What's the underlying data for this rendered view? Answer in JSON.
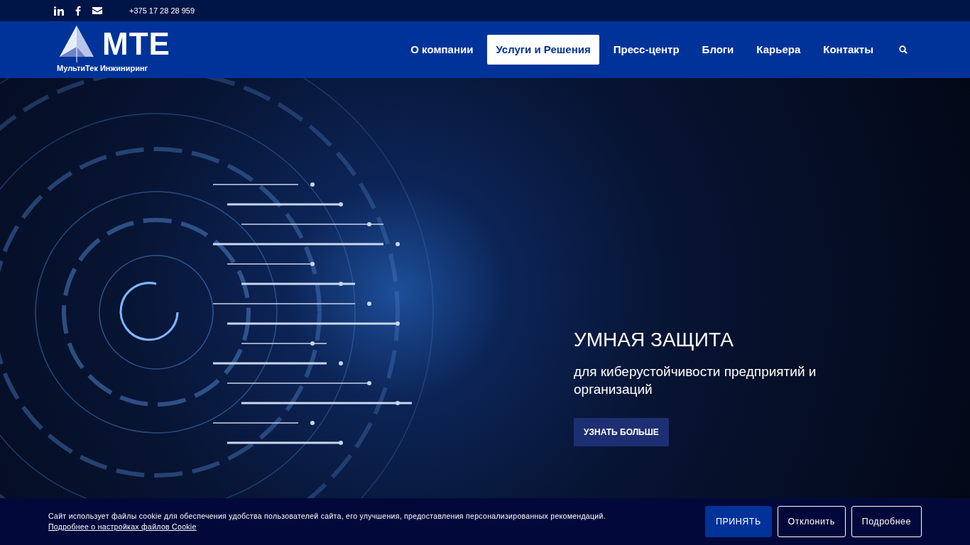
{
  "topbar": {
    "phone": "+375 17 28 28 959"
  },
  "logo": {
    "wordmark": "MTE",
    "subtitle": "МультиТек Инжиниринг"
  },
  "nav": {
    "items": [
      {
        "label": "О компании",
        "selected": false
      },
      {
        "label": "Услуги и Решения",
        "selected": true
      },
      {
        "label": "Пресс-центр",
        "selected": false
      },
      {
        "label": "Блоги",
        "selected": false
      },
      {
        "label": "Карьера",
        "selected": false
      },
      {
        "label": "Контакты",
        "selected": false
      }
    ]
  },
  "hero": {
    "title": "УМНАЯ ЗАЩИТА",
    "subtitle": "для киберустойчивости предприятий и организаций",
    "button": "УЗНАТЬ БОЛЬШЕ"
  },
  "cookie_banner": {
    "text": "Сайт использует файлы cookie для обеспечения удобства пользователей сайта, его улучшения, предоставления персонализированных рекомендаций.",
    "link": "Подробнее о настройках файлов Cookie",
    "buttons": [
      {
        "label": "ПРИНЯТЬ",
        "kind": "primary"
      },
      {
        "label": "Отклонить",
        "kind": "outline"
      },
      {
        "label": "Подробнее",
        "kind": "outline"
      }
    ]
  }
}
